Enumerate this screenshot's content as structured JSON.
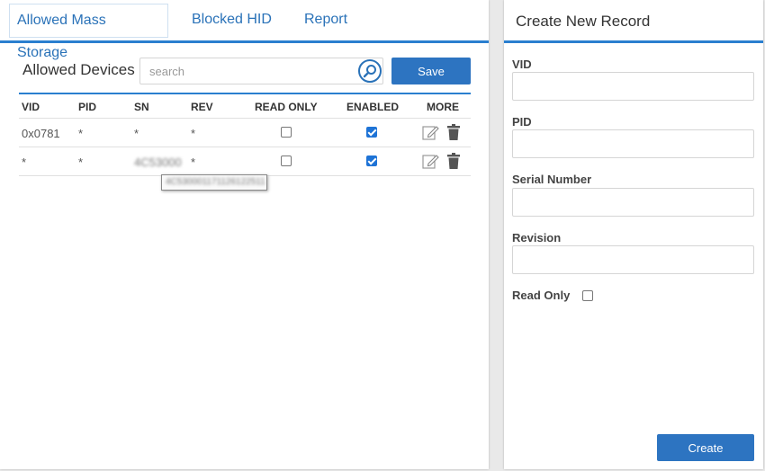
{
  "tabs": [
    {
      "label": "Allowed Mass Storage",
      "active": true
    },
    {
      "label": "Blocked HID",
      "active": false
    },
    {
      "label": "Report",
      "active": false
    }
  ],
  "allowed": {
    "title": "Allowed Devices",
    "search_placeholder": "search",
    "save_label": "Save",
    "columns": [
      "VID",
      "PID",
      "SN",
      "REV",
      "READ ONLY",
      "ENABLED",
      "MORE"
    ],
    "rows": [
      {
        "vid": "0x0781",
        "pid": "*",
        "sn": "*",
        "rev": "*",
        "read_only": false,
        "enabled": true
      },
      {
        "vid": "*",
        "pid": "*",
        "sn": "4C53000",
        "rev": "*",
        "read_only": false,
        "enabled": true
      }
    ],
    "tooltip": "4C530001171126122511"
  },
  "create": {
    "title": "Create New Record",
    "fields": [
      {
        "label": "VID",
        "value": ""
      },
      {
        "label": "PID",
        "value": ""
      },
      {
        "label": "Serial Number",
        "value": ""
      },
      {
        "label": "Revision",
        "value": ""
      }
    ],
    "read_only_label": "Read Only",
    "read_only": false,
    "create_label": "Create"
  },
  "colors": {
    "accent": "#2a7fcf",
    "button": "#2d74c1",
    "checkbox": "#1e73d6"
  },
  "icons": [
    "search-icon",
    "edit-icon",
    "trash-icon"
  ]
}
